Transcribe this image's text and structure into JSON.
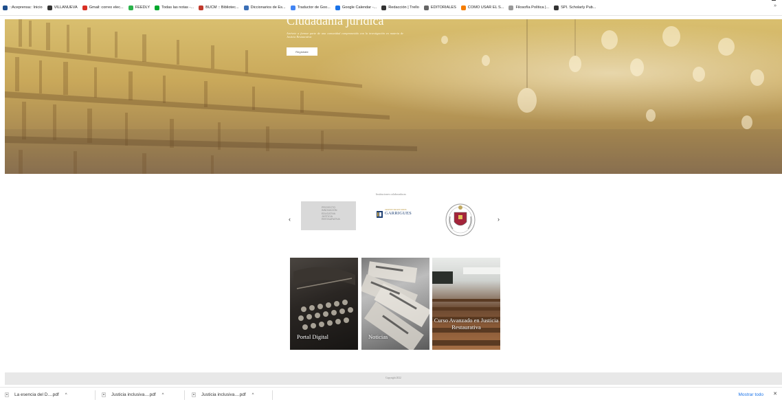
{
  "bookmarks": [
    {
      "label": "::Aceprensa:: Inicio",
      "icon": "aceprensa-icon",
      "color": "#1f4e8c"
    },
    {
      "label": "VILLANUEVA",
      "icon": "globe-icon",
      "color": "#333333"
    },
    {
      "label": "Gmail: correo elec...",
      "icon": "gmail-icon",
      "color": "#d93025"
    },
    {
      "label": "FEEDLY",
      "icon": "feedly-icon",
      "color": "#2bb24c"
    },
    {
      "label": "Todas las notas -...",
      "icon": "evernote-icon",
      "color": "#00a82d"
    },
    {
      "label": "BUCM :: Bibliotec...",
      "icon": "bucm-icon",
      "color": "#c0392b"
    },
    {
      "label": "Diccionarios de Es...",
      "icon": "dictionary-icon",
      "color": "#3b6fb6"
    },
    {
      "label": "Traductor de Goo...",
      "icon": "translate-icon",
      "color": "#4285f4"
    },
    {
      "label": "Google Calendar -...",
      "icon": "calendar-icon",
      "color": "#1a73e8"
    },
    {
      "label": "Redacción | Trello",
      "icon": "trello-icon",
      "color": "#333333"
    },
    {
      "label": "EDITORIALES",
      "icon": "folder-icon",
      "color": "#666666"
    },
    {
      "label": "COMO USAR EL S...",
      "icon": "blogger-icon",
      "color": "#f57d00"
    },
    {
      "label": "Filosofía Política |...",
      "icon": "circle-icon",
      "color": "#999999"
    },
    {
      "label": "SPI. Scholarly Pub...",
      "icon": "globe-icon",
      "color": "#333333"
    }
  ],
  "bookmarks_more": "»",
  "hero": {
    "title": "Ciudadanía jurídica",
    "subtitle": "Atrévete a formar parte de una comunidad comprometida con la investigación en materia de Justicia Restaurativa",
    "button_label": "Regístrate"
  },
  "collaborators": {
    "title": "Instituciones colaboradoras",
    "prev": "‹",
    "next": "›",
    "logo1_text": [
      "PROYECTO",
      "INNOVACIÓN",
      "EDUCATIVA",
      "JUSTICIA",
      "RESTAURATIVA"
    ],
    "logo2_small": "CENTRO DE ESTUDIOS",
    "logo2_big": "GARRIGUES"
  },
  "cards": [
    {
      "label": "Portal Digital"
    },
    {
      "label": "Noticias"
    },
    {
      "label": "Curso Avanzado en Justicia Restaurativa"
    }
  ],
  "footer": {
    "copyright": "Copyright 2022"
  },
  "downloads": {
    "items": [
      {
        "name": "La esencia del D....pdf"
      },
      {
        "name": "Justicia inclusiva....pdf"
      },
      {
        "name": "Justicia inclusiva....pdf"
      }
    ],
    "chevron": "^",
    "show_all": "Mostrar todo",
    "close": "✕"
  }
}
